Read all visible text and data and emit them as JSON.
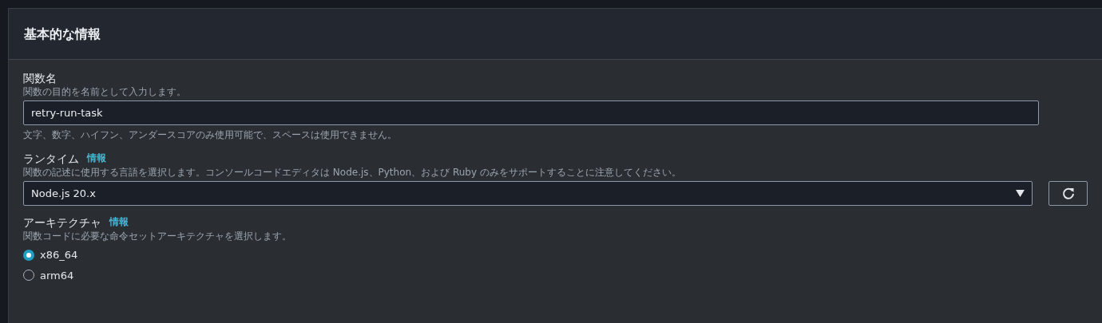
{
  "panel": {
    "title": "基本的な情報"
  },
  "fields": [
    {
      "kind": "text",
      "label": "関数名",
      "description": "関数の目的を名前として入力します。",
      "value": "retry-run-task",
      "hint": "文字、数字、ハイフン、アンダースコアのみ使用可能で、スペースは使用できません。"
    },
    {
      "kind": "select",
      "label": "ランタイム",
      "info": "情報",
      "description": "関数の記述に使用する言語を選択します。コンソールコードエディタは Node.js、Python、および Ruby のみをサポートすることに注意してください。",
      "value": "Node.js 20.x"
    },
    {
      "kind": "radio",
      "label": "アーキテクチャ",
      "info": "情報",
      "description": "関数コードに必要な命令セットアーキテクチャを選択します。",
      "options": [
        {
          "label": "x86_64",
          "selected": true
        },
        {
          "label": "arm64",
          "selected": false
        }
      ]
    }
  ]
}
